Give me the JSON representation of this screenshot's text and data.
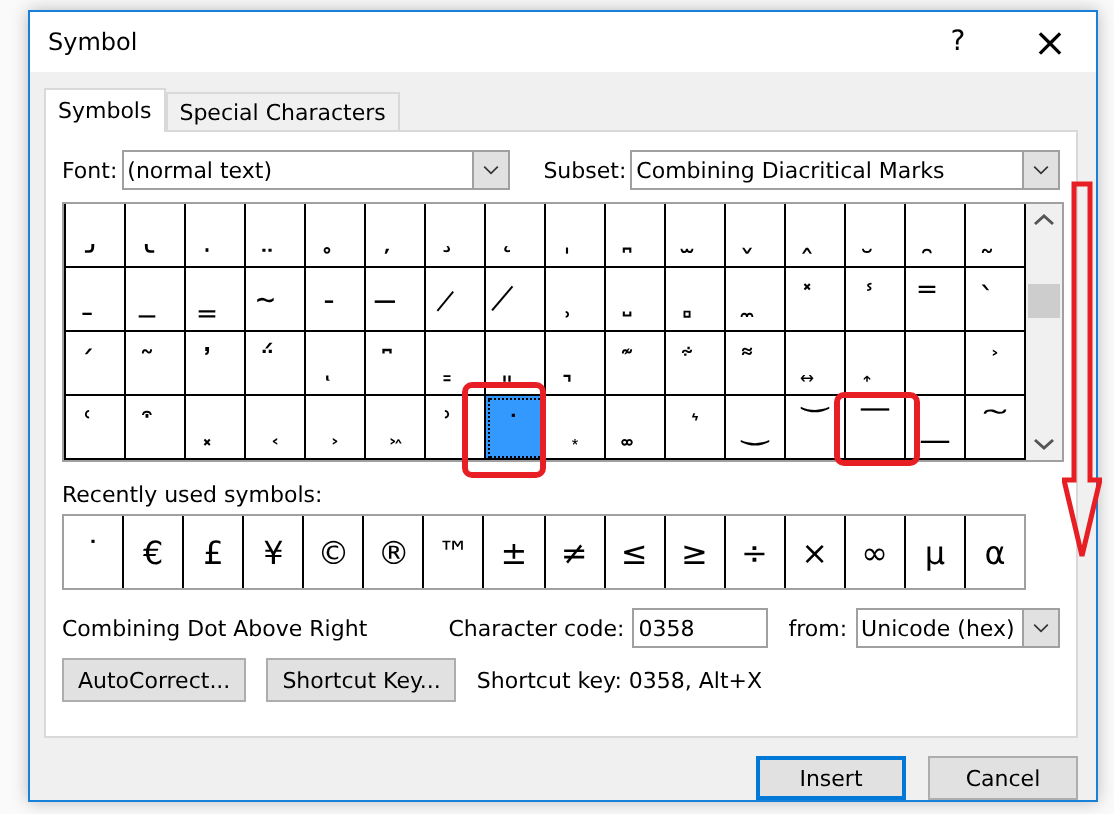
{
  "window": {
    "title": "Symbol",
    "help": "?",
    "close": "×"
  },
  "tabs": [
    {
      "label": "Symbols",
      "selected": true
    },
    {
      "label": "Special Characters",
      "selected": false
    }
  ],
  "font": {
    "label": "Font:",
    "value": "(normal text)"
  },
  "subset": {
    "label": "Subset:",
    "value": "Combining Diacritical Marks"
  },
  "grid": [
    {
      "char": "̡",
      "selected": false
    },
    {
      "char": "̢",
      "selected": false
    },
    {
      "char": "̣",
      "selected": false
    },
    {
      "char": "̤",
      "selected": false
    },
    {
      "char": "̥",
      "selected": false
    },
    {
      "char": "̦",
      "selected": false
    },
    {
      "char": "̧",
      "selected": false
    },
    {
      "char": "̨",
      "selected": false
    },
    {
      "char": "̩",
      "selected": false
    },
    {
      "char": "̪",
      "selected": false
    },
    {
      "char": "̫",
      "selected": false
    },
    {
      "char": "̬",
      "selected": false
    },
    {
      "char": "̭",
      "selected": false
    },
    {
      "char": "̮",
      "selected": false
    },
    {
      "char": "̯",
      "selected": false
    },
    {
      "char": "̰",
      "selected": false
    },
    {
      "char": "̱",
      "selected": false
    },
    {
      "char": "̲",
      "selected": false
    },
    {
      "char": "̳",
      "selected": false
    },
    {
      "char": "̴",
      "selected": false
    },
    {
      "char": "̵",
      "selected": false
    },
    {
      "char": "̶",
      "selected": false
    },
    {
      "char": "̷",
      "selected": false
    },
    {
      "char": "̸",
      "selected": false
    },
    {
      "char": "̹",
      "selected": false
    },
    {
      "char": "̺",
      "selected": false
    },
    {
      "char": "̻",
      "selected": false
    },
    {
      "char": "̼",
      "selected": false
    },
    {
      "char": "̽",
      "selected": false
    },
    {
      "char": "̾",
      "selected": false
    },
    {
      "char": "̿",
      "selected": false
    },
    {
      "char": "̀",
      "selected": false
    },
    {
      "char": "́",
      "selected": false
    },
    {
      "char": "͂",
      "selected": false
    },
    {
      "char": "̓",
      "selected": false
    },
    {
      "char": "̈́",
      "selected": false
    },
    {
      "char": "ͅ",
      "selected": false
    },
    {
      "char": "͆",
      "selected": false
    },
    {
      "char": "͇",
      "selected": false
    },
    {
      "char": "͈",
      "selected": false
    },
    {
      "char": "͉",
      "selected": false
    },
    {
      "char": "͊",
      "selected": false
    },
    {
      "char": "͋",
      "selected": false
    },
    {
      "char": "͌",
      "selected": false
    },
    {
      "char": "͍",
      "selected": false
    },
    {
      "char": "͎",
      "selected": false
    },
    {
      "selected": false
    },
    {
      "char": "͐",
      "selected": false
    },
    {
      "char": "͑",
      "selected": false
    },
    {
      "char": "͒",
      "selected": false
    },
    {
      "char": "͓",
      "selected": false
    },
    {
      "char": "͔",
      "selected": false
    },
    {
      "char": "͕",
      "selected": false
    },
    {
      "char": "͖",
      "selected": false
    },
    {
      "char": "͗",
      "selected": false
    },
    {
      "char": "͘",
      "selected": true
    },
    {
      "char": "͙",
      "selected": false
    },
    {
      "char": "͚",
      "selected": false
    },
    {
      "char": "͛",
      "selected": false
    },
    {
      "char": "͜",
      "selected": false
    },
    {
      "char": "͝",
      "selected": false
    },
    {
      "char": "͞",
      "selected": false
    },
    {
      "char": "͟",
      "selected": false
    },
    {
      "char": "͠",
      "selected": false
    }
  ],
  "recent": {
    "label": "Recently used symbols:",
    "symbols": [
      "˙",
      "€",
      "£",
      "¥",
      "©",
      "®",
      "™",
      "±",
      "≠",
      "≤",
      "≥",
      "÷",
      "×",
      "∞",
      "µ",
      "α"
    ]
  },
  "description": "Combining Dot Above Right",
  "character_code": {
    "label": "Character code:",
    "value": "0358"
  },
  "from": {
    "label": "from:",
    "value": "Unicode (hex)"
  },
  "buttons": [
    "AutoCorrect...",
    "Shortcut Key..."
  ],
  "shortcut": "Shortcut key: 0358, Alt+X",
  "actions": [
    {
      "label": "Insert",
      "default": true
    },
    {
      "label": "Cancel",
      "default": false
    }
  ]
}
